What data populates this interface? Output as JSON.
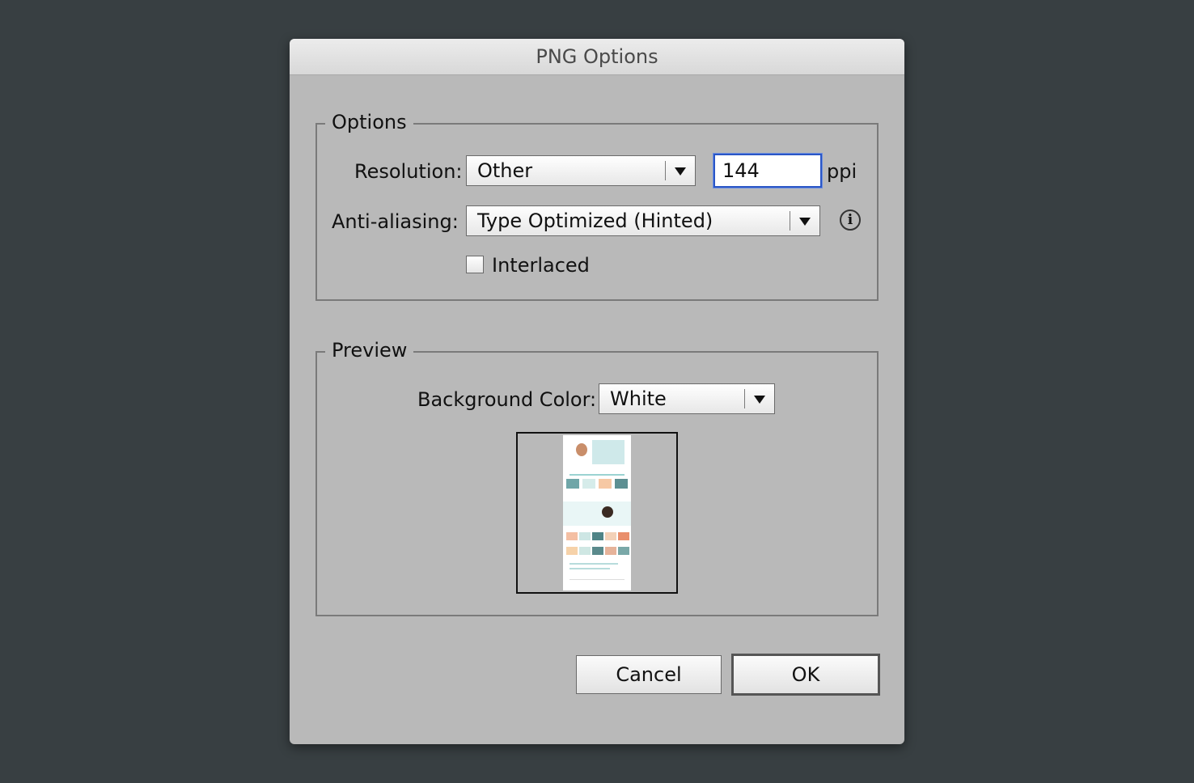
{
  "dialog": {
    "title": "PNG Options"
  },
  "options": {
    "legend": "Options",
    "resolution_label": "Resolution:",
    "resolution_value": "Other",
    "ppi_value": "144",
    "ppi_unit": "ppi",
    "antialias_label": "Anti-aliasing:",
    "antialias_value": "Type Optimized (Hinted)",
    "interlaced_label": "Interlaced",
    "interlaced_checked": false
  },
  "preview": {
    "legend": "Preview",
    "bg_label": "Background Color:",
    "bg_value": "White"
  },
  "buttons": {
    "cancel": "Cancel",
    "ok": "OK"
  },
  "colors": {
    "screen_bg": "#383f42",
    "dialog_bg": "#b9b9b9",
    "focus_ring": "#2a56c6"
  },
  "icons": {
    "info": "info-icon",
    "dropdown": "triangle-down-icon"
  }
}
